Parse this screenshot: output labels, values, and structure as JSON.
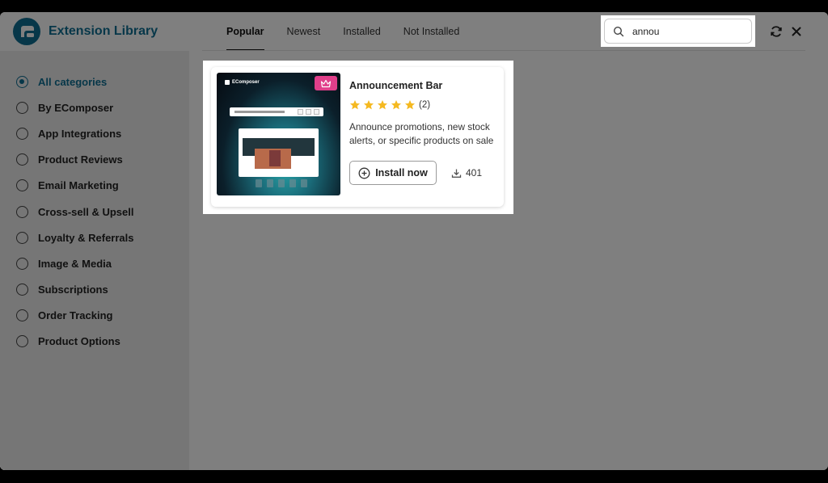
{
  "header": {
    "title": "Extension Library",
    "tabs": [
      {
        "label": "Popular",
        "active": true
      },
      {
        "label": "Newest",
        "active": false
      },
      {
        "label": "Installed",
        "active": false
      },
      {
        "label": "Not Installed",
        "active": false
      }
    ],
    "search": {
      "value": "annou",
      "icon": "search-icon"
    },
    "actions": {
      "refresh_icon": "refresh-icon",
      "close_icon": "close-icon"
    }
  },
  "sidebar": {
    "items": [
      {
        "label": "All categories",
        "selected": true
      },
      {
        "label": "By EComposer",
        "selected": false
      },
      {
        "label": "App Integrations",
        "selected": false
      },
      {
        "label": "Product Reviews",
        "selected": false
      },
      {
        "label": "Email Marketing",
        "selected": false
      },
      {
        "label": "Cross-sell & Upsell",
        "selected": false
      },
      {
        "label": "Loyalty & Referrals",
        "selected": false
      },
      {
        "label": "Image & Media",
        "selected": false
      },
      {
        "label": "Subscriptions",
        "selected": false
      },
      {
        "label": "Order Tracking",
        "selected": false
      },
      {
        "label": "Product Options",
        "selected": false
      }
    ]
  },
  "results": [
    {
      "title": "Announcement Bar",
      "thumbnail_brand": "EComposer",
      "premium_icon": "crown-icon",
      "rating": 5,
      "rating_count": "(2)",
      "description": "Announce promotions, new stock alerts, or specific products on sale",
      "install_label": "Install now",
      "downloads": "401"
    }
  ],
  "colors": {
    "brand": "#0e6f93",
    "star": "#f5b921",
    "premium_badge": "#e03f8a",
    "sidebar_bg": "#ececec"
  }
}
